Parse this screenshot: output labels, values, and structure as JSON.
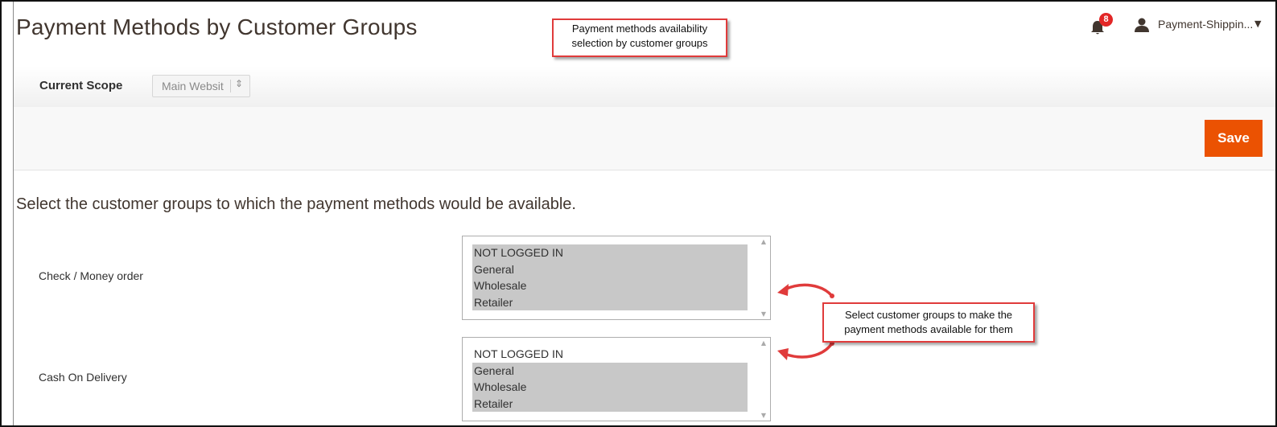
{
  "header": {
    "title": "Payment Methods by Customer Groups",
    "notification_count": "8",
    "user_name": "Payment-Shippin...",
    "icons": {
      "notifications": "bell-icon",
      "user": "user-icon",
      "dropdown": "caret-down-icon"
    }
  },
  "callouts": {
    "top": {
      "line1": "Payment methods availability",
      "line2": "selection by customer groups"
    },
    "side": {
      "line1": "Select customer groups to make the",
      "line2": "payment methods available for them"
    }
  },
  "scope": {
    "label": "Current Scope",
    "selected": "Main Websit"
  },
  "actions": {
    "save_label": "Save"
  },
  "main": {
    "description": "Select the customer groups to which the payment methods would be available.",
    "methods": [
      {
        "label": "Check / Money order",
        "options": [
          {
            "label": "NOT LOGGED IN",
            "selected": true
          },
          {
            "label": "General",
            "selected": true
          },
          {
            "label": "Wholesale",
            "selected": true
          },
          {
            "label": "Retailer",
            "selected": true
          }
        ]
      },
      {
        "label": "Cash On Delivery",
        "options": [
          {
            "label": "NOT LOGGED IN",
            "selected": false
          },
          {
            "label": "General",
            "selected": true
          },
          {
            "label": "Wholesale",
            "selected": true
          },
          {
            "label": "Retailer",
            "selected": true
          }
        ]
      }
    ]
  },
  "colors": {
    "accent": "#eb5202",
    "callout_border": "#e03b3b",
    "badge": "#e22626",
    "selected_option": "#c8c8c8"
  }
}
